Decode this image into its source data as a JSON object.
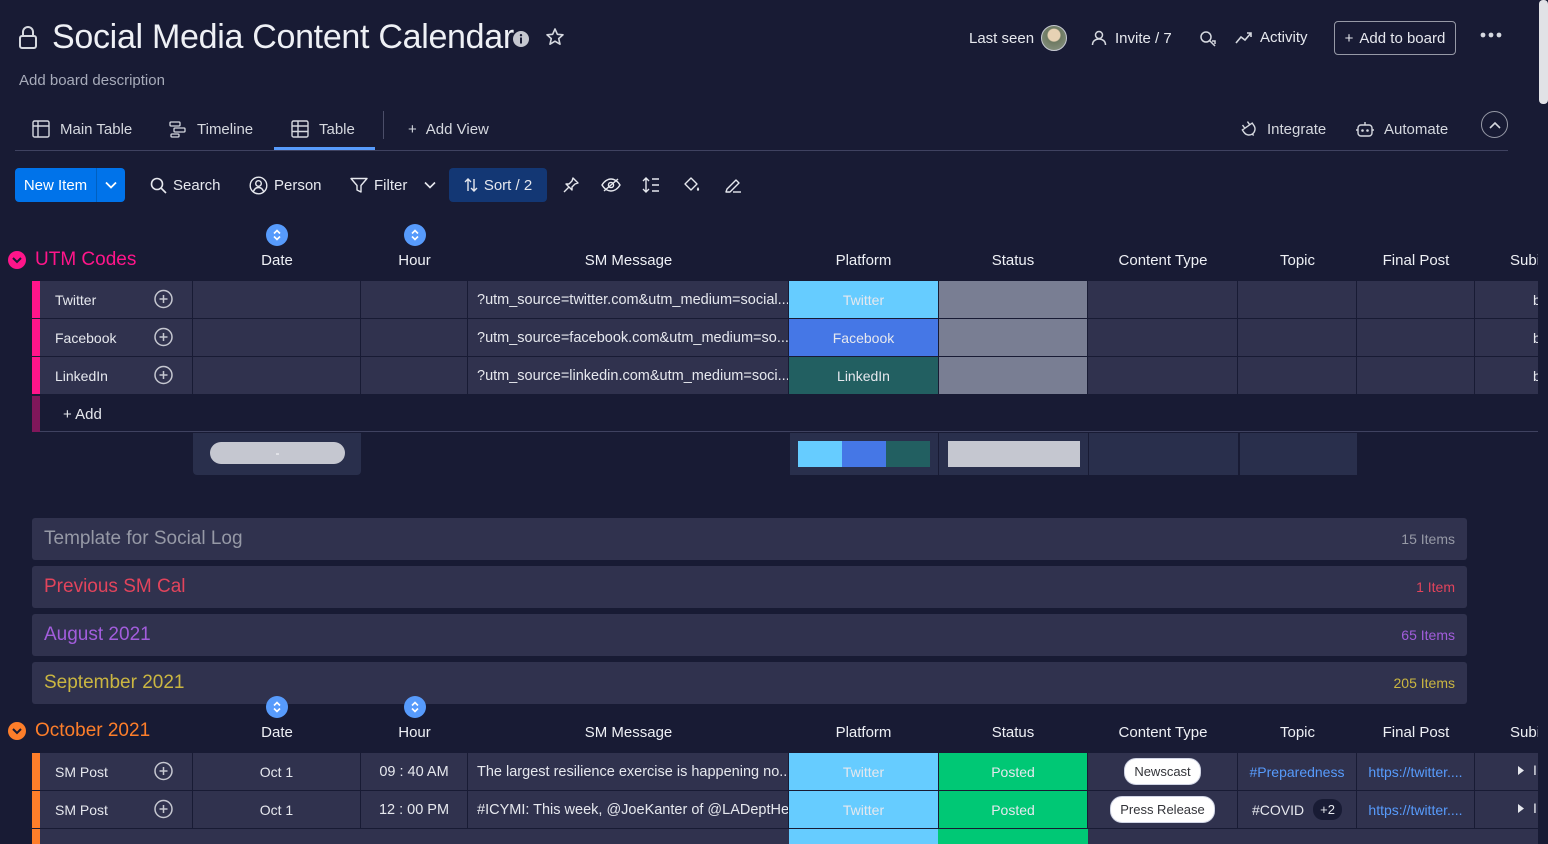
{
  "board": {
    "title": "Social Media Content Calendar",
    "description": "Add board description"
  },
  "header": {
    "last_seen": "Last seen",
    "invite": "Invite / 7",
    "activity": "Activity",
    "add_to_board": "Add to board"
  },
  "tabs": {
    "main_table": "Main Table",
    "timeline": "Timeline",
    "table": "Table",
    "add_view": "Add View",
    "integrate": "Integrate",
    "automate": "Automate",
    "active": "Table"
  },
  "toolbar": {
    "new_item": "New Item",
    "search": "Search",
    "person": "Person",
    "filter": "Filter",
    "sort": "Sort / 2"
  },
  "columns": [
    "Date",
    "Hour",
    "SM Message",
    "Platform",
    "Status",
    "Content Type",
    "Topic",
    "Final Post",
    "Subi"
  ],
  "group_utm": {
    "title": "UTM Codes",
    "color": "#ff158a",
    "rows": [
      {
        "name": "Twitter",
        "message": "?utm_source=twitter.com&utm_medium=social...",
        "platform": "Twitter",
        "platform_color": "#66ccff",
        "trail": "b"
      },
      {
        "name": "Facebook",
        "message": "?utm_source=facebook.com&utm_medium=so...",
        "platform": "Facebook",
        "platform_color": "#4577e6",
        "trail": "b"
      },
      {
        "name": "LinkedIn",
        "message": "?utm_source=linkedin.com&utm_medium=soci...",
        "platform": "LinkedIn",
        "platform_color": "#225f61",
        "trail": "b"
      }
    ],
    "add_label": "+ Add",
    "date_summary": "-",
    "status_color": "#797e93"
  },
  "collapsed_groups": [
    {
      "title": "Template for Social Log",
      "count": "15 Items",
      "color": "#9699a6"
    },
    {
      "title": "Previous SM Cal",
      "count": "1 Item",
      "color": "#e2445c"
    },
    {
      "title": "August 2021",
      "count": "65 Items",
      "color": "#a25ddc"
    },
    {
      "title": "September 2021",
      "count": "205 Items",
      "color": "#cab641"
    }
  ],
  "group_oct": {
    "title": "October 2021",
    "color": "#fd7e2a",
    "rows": [
      {
        "name": "SM Post",
        "date": "Oct 1",
        "hour": "09 : 40 AM",
        "message": "The largest resilience exercise is happening no...",
        "platform": "Twitter",
        "status": "Posted",
        "content_type": "Newscast",
        "topic": "#Preparedness",
        "topic_extra": "",
        "final_post": "https://twitter....",
        "trail": "I"
      },
      {
        "name": "SM Post",
        "date": "Oct 1",
        "hour": "12 : 00 PM",
        "message": "#ICYMI: This week, @JoeKanter of @LADeptHe...",
        "platform": "Twitter",
        "status": "Posted",
        "content_type": "Press Release",
        "topic": "#COVID",
        "topic_extra": "+2",
        "final_post": "https://twitter....",
        "trail": "I"
      }
    ]
  },
  "colors": {
    "background": "#181b34",
    "cell": "#30324e",
    "primary": "#0073ea",
    "twitter": "#66ccff",
    "posted": "#00c875"
  }
}
